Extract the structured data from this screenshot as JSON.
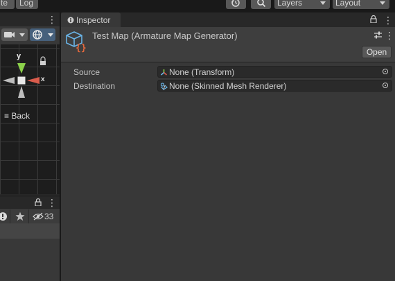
{
  "toolbar": {
    "btn_left1": "te",
    "btn_left2": "Log",
    "layers_label": "Layers",
    "layout_label": "Layout"
  },
  "scene": {
    "axis_y": "y",
    "axis_x": "x",
    "back_label": "Back"
  },
  "hierarchy": {
    "hidden_count": "33"
  },
  "inspector": {
    "tab_label": "Inspector",
    "object_title": "Test Map (Armature Map Generator)",
    "open_button": "Open",
    "fields": [
      {
        "label": "Source",
        "value": "None (Transform)"
      },
      {
        "label": "Destination",
        "value": "None (Skinned Mesh Renderer)"
      }
    ]
  },
  "colors": {
    "accent_green": "#8bd14a",
    "accent_red": "#d95c4c",
    "script_icon_blue": "#6ab5e8",
    "script_icon_orange": "#e2683d"
  }
}
